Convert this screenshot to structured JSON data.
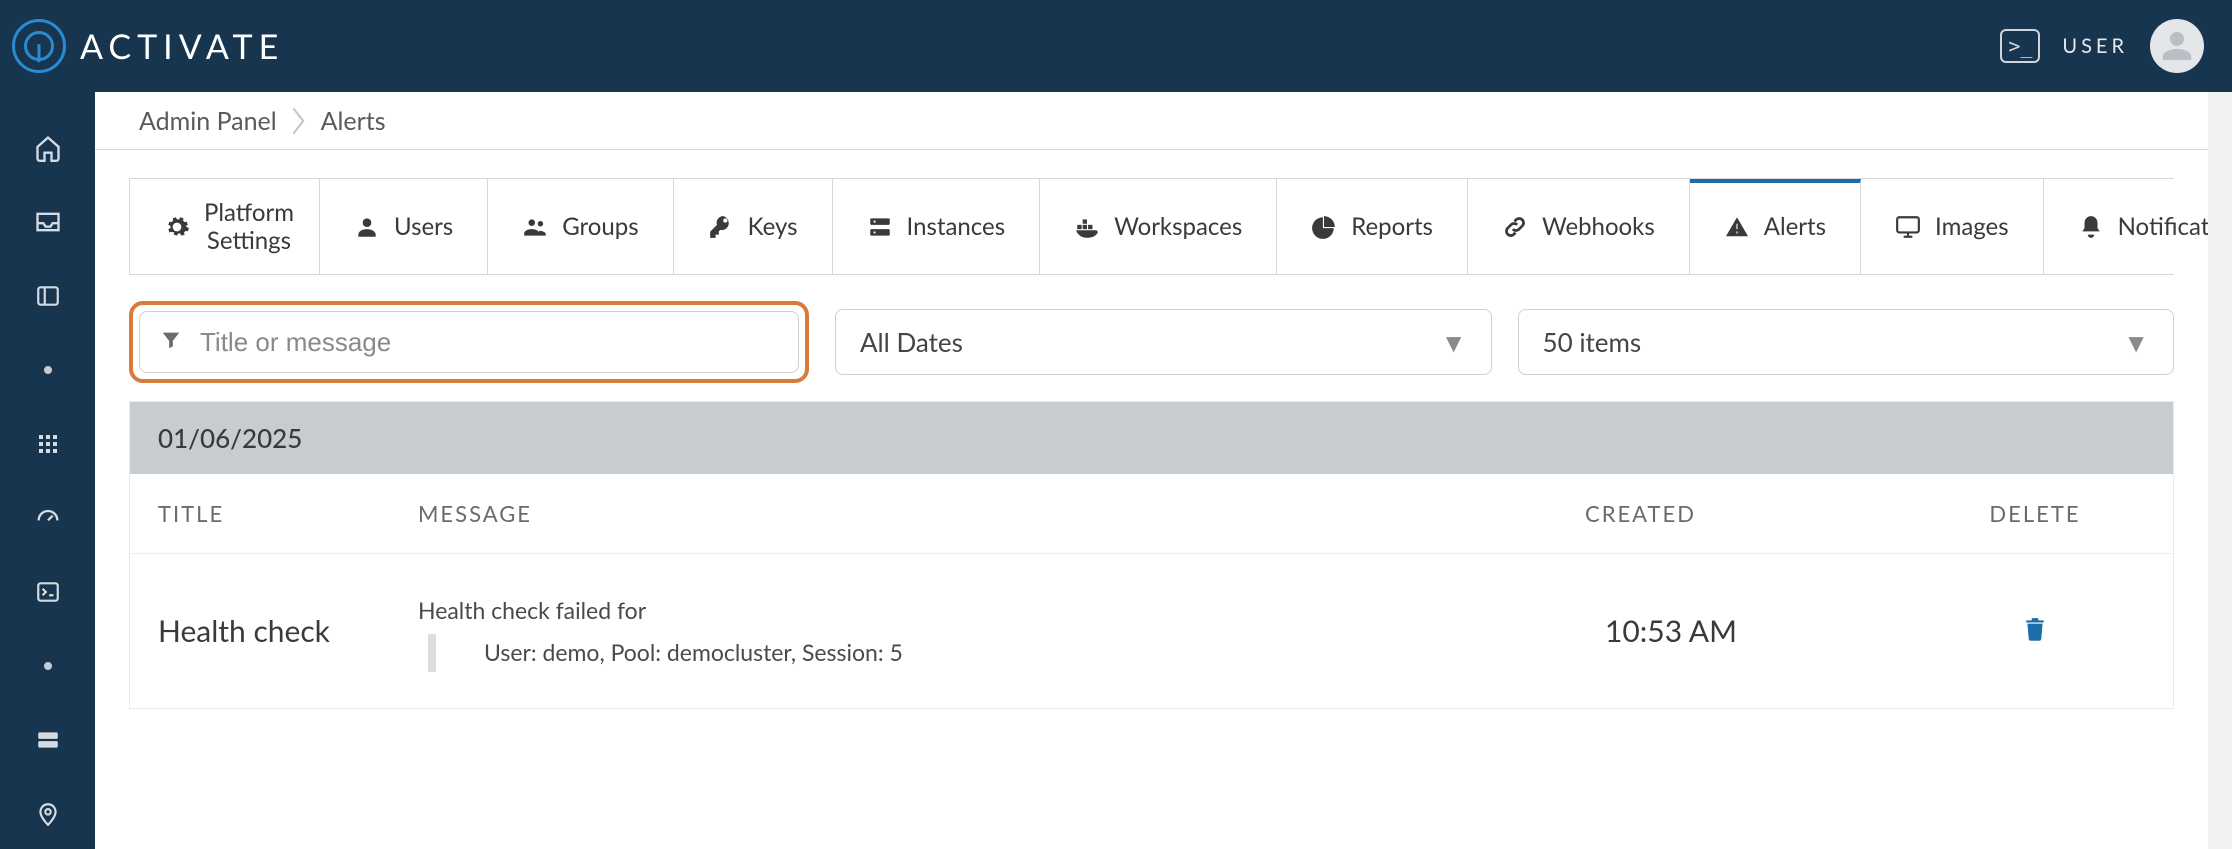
{
  "brand": "ACTIVATE",
  "topbar": {
    "user_label": "USER"
  },
  "breadcrumbs": [
    "Admin Panel",
    "Alerts"
  ],
  "tabs": [
    {
      "id": "platform-settings",
      "label": "Platform Settings",
      "icon": "gears"
    },
    {
      "id": "users",
      "label": "Users",
      "icon": "person"
    },
    {
      "id": "groups",
      "label": "Groups",
      "icon": "people"
    },
    {
      "id": "keys",
      "label": "Keys",
      "icon": "key"
    },
    {
      "id": "instances",
      "label": "Instances",
      "icon": "server"
    },
    {
      "id": "workspaces",
      "label": "Workspaces",
      "icon": "docker"
    },
    {
      "id": "reports",
      "label": "Reports",
      "icon": "pie"
    },
    {
      "id": "webhooks",
      "label": "Webhooks",
      "icon": "link"
    },
    {
      "id": "alerts",
      "label": "Alerts",
      "icon": "warning",
      "active": true
    },
    {
      "id": "images",
      "label": "Images",
      "icon": "monitor"
    },
    {
      "id": "notifications",
      "label": "Notifications",
      "icon": "bell"
    }
  ],
  "filters": {
    "search_placeholder": "Title or message",
    "date_label": "All Dates",
    "page_size_label": "50 items"
  },
  "table": {
    "group_date": "01/06/2025",
    "columns": {
      "title": "TITLE",
      "message": "MESSAGE",
      "created": "CREATED",
      "delete": "DELETE"
    },
    "rows": [
      {
        "title": "Health check",
        "message_line1": "Health check failed for",
        "message_line2": "User: demo, Pool: democluster, Session: 5",
        "created": "10:53 AM"
      }
    ]
  }
}
